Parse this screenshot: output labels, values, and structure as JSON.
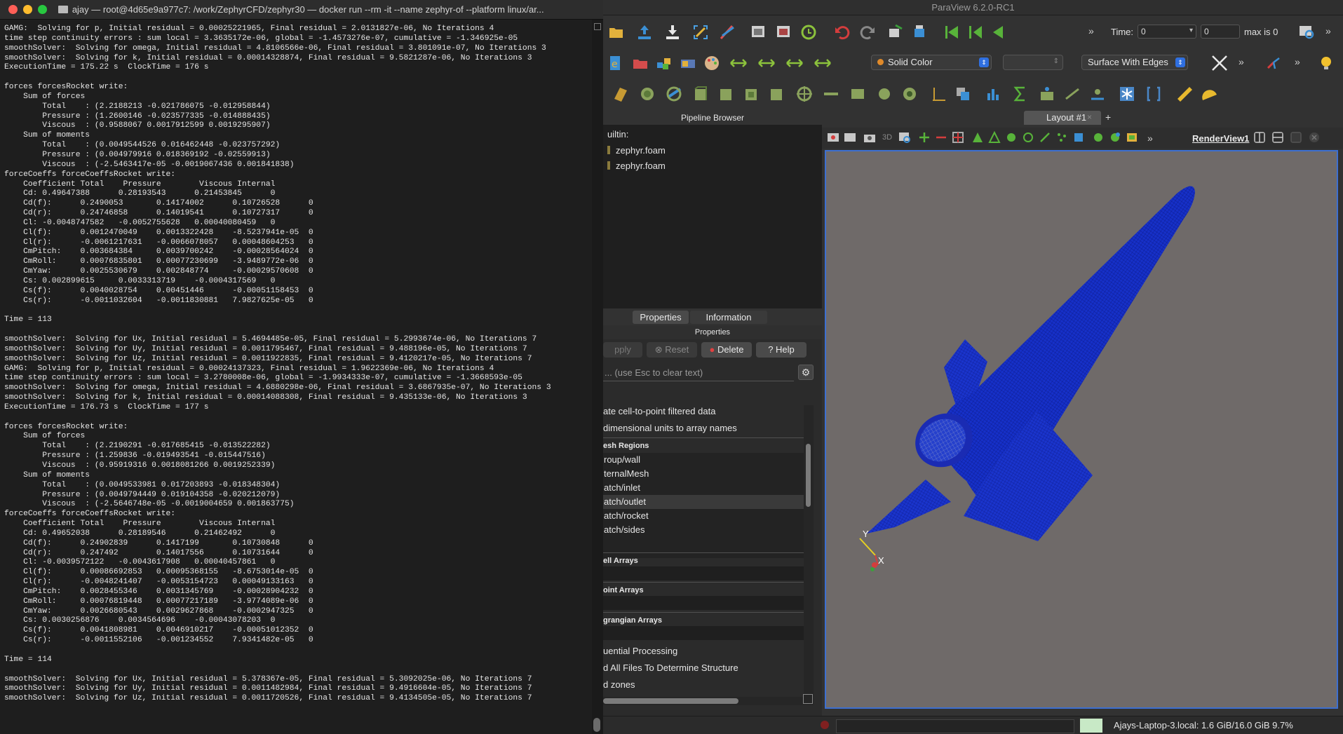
{
  "terminal": {
    "title": "ajay — root@4d65e9a977c7: /work/ZephyrCFD/zephyr30 — docker run --rm -it --name zephyr-of --platform linux/ar...",
    "lines": [
      "GAMG:  Solving for p, Initial residual = 0.00025221965, Final residual = 2.0131827e-06, No Iterations 4",
      "time step continuity errors : sum local = 3.3635172e-06, global = -1.4573276e-07, cumulative = -1.346925e-05",
      "smoothSolver:  Solving for omega, Initial residual = 4.8106566e-06, Final residual = 3.801091e-07, No Iterations 3",
      "smoothSolver:  Solving for k, Initial residual = 0.00014328874, Final residual = 9.5821287e-06, No Iterations 3",
      "ExecutionTime = 175.22 s  ClockTime = 176 s",
      "",
      "forces forcesRocket write:",
      "    Sum of forces",
      "        Total    : (2.2188213 -0.021786075 -0.012958844)",
      "        Pressure : (1.2600146 -0.023577335 -0.014888435)",
      "        Viscous  : (0.9588067 0.0017912599 0.0019295907)",
      "    Sum of moments",
      "        Total    : (0.0049544526 0.016462448 -0.023757292)",
      "        Pressure : (0.004979916 0.018369192 -0.02559913)",
      "        Viscous  : (-2.5463417e-05 -0.0019067436 0.001841838)",
      "forceCoeffs forceCoeffsRocket write:",
      "    Coefficient Total    Pressure        Viscous Internal",
      "    Cd: 0.49647388      0.28193543      0.21453845      0",
      "    Cd(f):      0.2490053       0.14174002      0.10726528      0",
      "    Cd(r):      0.24746858      0.14019541      0.10727317      0",
      "    Cl: -0.0048747582   -0.0052755628   0.00040080459   0",
      "    Cl(f):      0.0012470049    0.0013322428    -8.5237941e-05  0",
      "    Cl(r):      -0.0061217631   -0.0066078057   0.00048604253   0",
      "    CmPitch:    0.003684384     0.0039700242    -0.00028564024  0",
      "    CmRoll:     0.00076835801   0.00077230699   -3.9489772e-06  0",
      "    CmYaw:      0.0025530679    0.002848774     -0.00029570608  0",
      "    Cs: 0.002899615     0.0033313719    -0.0004317569   0",
      "    Cs(f):      0.0040028754    0.00451446      -0.00051158453  0",
      "    Cs(r):      -0.0011032604   -0.0011830881   7.9827625e-05   0",
      "",
      "Time = 113",
      "",
      "smoothSolver:  Solving for Ux, Initial residual = 5.4694485e-05, Final residual = 5.2993674e-06, No Iterations 7",
      "smoothSolver:  Solving for Uy, Initial residual = 0.0011795467, Final residual = 9.488196e-05, No Iterations 7",
      "smoothSolver:  Solving for Uz, Initial residual = 0.0011922835, Final residual = 9.4120217e-05, No Iterations 7",
      "GAMG:  Solving for p, Initial residual = 0.00024137323, Final residual = 1.9622369e-06, No Iterations 4",
      "time step continuity errors : sum local = 3.2780008e-06, global = -1.9934333e-07, cumulative = -1.3668593e-05",
      "smoothSolver:  Solving for omega, Initial residual = 4.6880298e-06, Final residual = 3.6867935e-07, No Iterations 3",
      "smoothSolver:  Solving for k, Initial residual = 0.00014088308, Final residual = 9.435133e-06, No Iterations 3",
      "ExecutionTime = 176.73 s  ClockTime = 177 s",
      "",
      "forces forcesRocket write:",
      "    Sum of forces",
      "        Total    : (2.2190291 -0.017685415 -0.013522282)",
      "        Pressure : (1.259836 -0.019493541 -0.015447516)",
      "        Viscous  : (0.95919316 0.0018081266 0.0019252339)",
      "    Sum of moments",
      "        Total    : (0.0049533981 0.017203893 -0.018348304)",
      "        Pressure : (0.0049794449 0.019104358 -0.020212079)",
      "        Viscous  : (-2.5646748e-05 -0.0019004659 0.001863775)",
      "forceCoeffs forceCoeffsRocket write:",
      "    Coefficient Total    Pressure        Viscous Internal",
      "    Cd: 0.49652038      0.28189546      0.21462492      0",
      "    Cd(f):      0.24902839      0.1417199       0.10730848      0",
      "    Cd(r):      0.247492        0.14017556      0.10731644      0",
      "    Cl: -0.0039572122   -0.0043617908   0.00040457861   0",
      "    Cl(f):      0.00086692853   0.00095368155   -8.6753014e-05  0",
      "    Cl(r):      -0.0048241407   -0.0053154723   0.00049133163   0",
      "    CmPitch:    0.0028455346    0.0031345769    -0.00028904232  0",
      "    CmRoll:     0.00076819448   0.00077217189   -3.9774089e-06  0",
      "    CmYaw:      0.0026680543    0.0029627868    -0.0002947325   0",
      "    Cs: 0.0030256876    0.0034564696    -0.00043078203  0",
      "    Cs(f):      0.0041808981    0.0046910217    -0.00051012352  0",
      "    Cs(r):      -0.0011552106   -0.001234552    7.9341482e-05   0",
      "",
      "Time = 114",
      "",
      "smoothSolver:  Solving for Ux, Initial residual = 5.378367e-05, Final residual = 5.3092025e-06, No Iterations 7",
      "smoothSolver:  Solving for Uy, Initial residual = 0.0011482984, Final residual = 9.4916604e-05, No Iterations 7",
      "smoothSolver:  Solving for Uz, Initial residual = 0.0011720526, Final residual = 9.4134505e-05, No Iterations 7"
    ]
  },
  "paraview": {
    "title": "ParaView 6.2.0-RC1",
    "time_label": "Time:",
    "time_value": "0",
    "time_step": "0",
    "max_label": "max is 0",
    "coloring_combo": "Solid Color",
    "representation_combo": "Surface With Edges",
    "pipeline_browser": {
      "title": "Pipeline Browser",
      "items": [
        "uiltin:",
        "zephyr.foam",
        "zephyr.foam"
      ]
    },
    "tabs": {
      "properties": "Properties",
      "information": "Information"
    },
    "properties_title": "Properties",
    "buttons": {
      "apply": "pply",
      "reset": "Reset",
      "delete": "Delete",
      "help": "Help"
    },
    "search_placeholder": "... (use Esc to clear text)",
    "options": [
      "ate cell-to-point filtered data",
      "dimensional units to array names"
    ],
    "mesh_regions_header": "esh Regions",
    "mesh_regions": [
      "roup/wall",
      "ternalMesh",
      "atch/inlet",
      "atch/outlet",
      "atch/rocket",
      "atch/sides"
    ],
    "cell_arrays": "ell Arrays",
    "point_arrays": "oint Arrays",
    "lagrangian_arrays": "grangian Arrays",
    "more_options": [
      "uential Processing",
      "d All Files To Determine Structure",
      "d zones"
    ],
    "layout_tab": "Layout #1",
    "render_view_label": "RenderView1",
    "axes": {
      "y": "Y",
      "x": "X"
    },
    "status_memory": "Ajays-Laptop-3.local: 1.6 GiB/16.0 GiB 9.7%",
    "colors": {
      "accent": "#3d6fd0",
      "mesh": "#1a2bb3",
      "background": "#6f6a69"
    }
  }
}
